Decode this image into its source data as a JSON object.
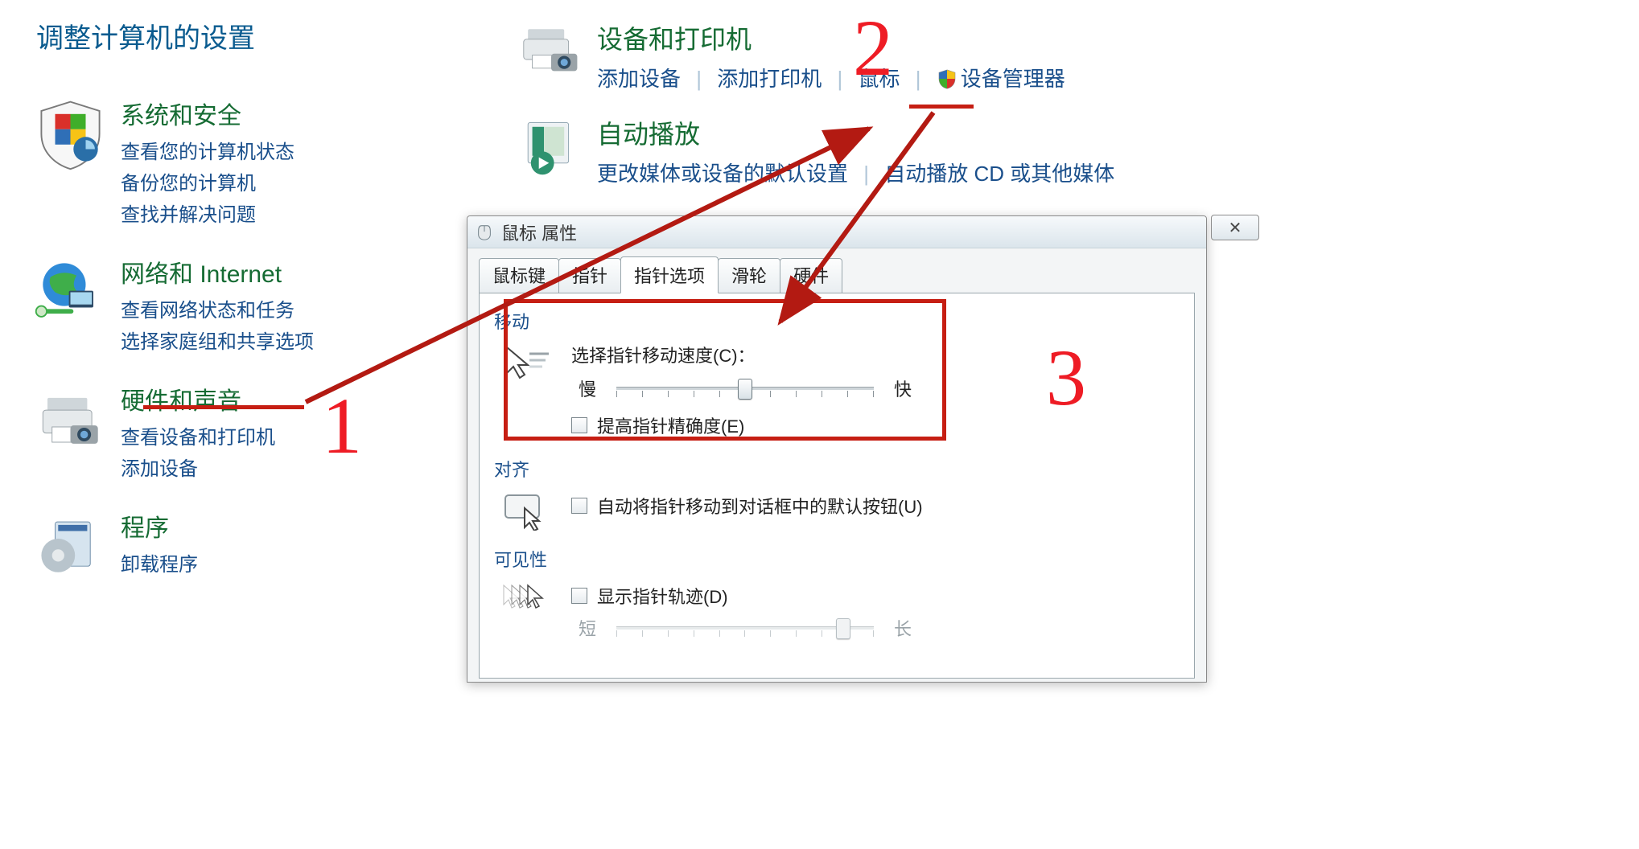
{
  "page_title": "调整计算机的设置",
  "categories": [
    {
      "key": "system-security",
      "heading": "系统和安全",
      "links": [
        "查看您的计算机状态",
        "备份您的计算机",
        "查找并解决问题"
      ]
    },
    {
      "key": "network",
      "heading": "网络和 Internet",
      "links": [
        "查看网络状态和任务",
        "选择家庭组和共享选项"
      ]
    },
    {
      "key": "hardware-sound",
      "heading": "硬件和声音",
      "links": [
        "查看设备和打印机",
        "添加设备"
      ]
    },
    {
      "key": "programs",
      "heading": "程序",
      "links": [
        "卸载程序"
      ]
    }
  ],
  "right_categories": {
    "devices": {
      "heading": "设备和打印机",
      "links": [
        "添加设备",
        "添加打印机",
        "鼠标",
        "设备管理器"
      ],
      "shield_on_index": 3
    },
    "autoplay": {
      "heading": "自动播放",
      "links": [
        "更改媒体或设备的默认设置",
        "自动播放 CD 或其他媒体"
      ]
    }
  },
  "dialog": {
    "title": "鼠标 属性",
    "close_symbol": "✕",
    "tabs": [
      "鼠标键",
      "指针",
      "指针选项",
      "滑轮",
      "硬件"
    ],
    "active_tab_index": 2,
    "pointer_options": {
      "motion": {
        "group_label": "移动",
        "speed_label": "选择指针移动速度(C)：",
        "slow_label": "慢",
        "fast_label": "快",
        "slider_value": 0.5,
        "enhance_precision_label": "提高指针精确度(E)",
        "enhance_precision_checked": false
      },
      "snap": {
        "group_label": "对齐",
        "snap_label": "自动将指针移动到对话框中的默认按钮(U)",
        "snap_checked": false
      },
      "visibility": {
        "group_label": "可见性",
        "trail_label": "显示指针轨迹(D)",
        "trail_checked": false,
        "trail_short_label": "短",
        "trail_long_label": "长",
        "trail_slider_value": 0.88,
        "trail_slider_enabled": false
      }
    }
  },
  "annotations": {
    "numbers": {
      "1": "1",
      "2": "2",
      "3": "3"
    }
  }
}
